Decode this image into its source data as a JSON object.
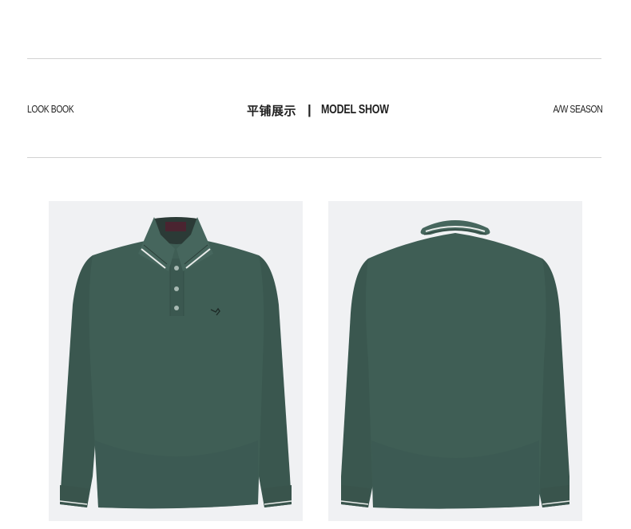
{
  "header": {
    "left_label": "LOOK BOOK",
    "center_cn": "平铺展示",
    "center_separator": "|",
    "center_en": "MODEL SHOW",
    "right_label": "A/W SEASON"
  },
  "products": [
    {
      "view": "front",
      "color": "#3f5e55"
    },
    {
      "view": "back",
      "color": "#3f5e55"
    }
  ],
  "colors": {
    "rule": "#d2d2d2",
    "photo_bg": "#f0f1f3",
    "shirt": "#3f5e55"
  }
}
